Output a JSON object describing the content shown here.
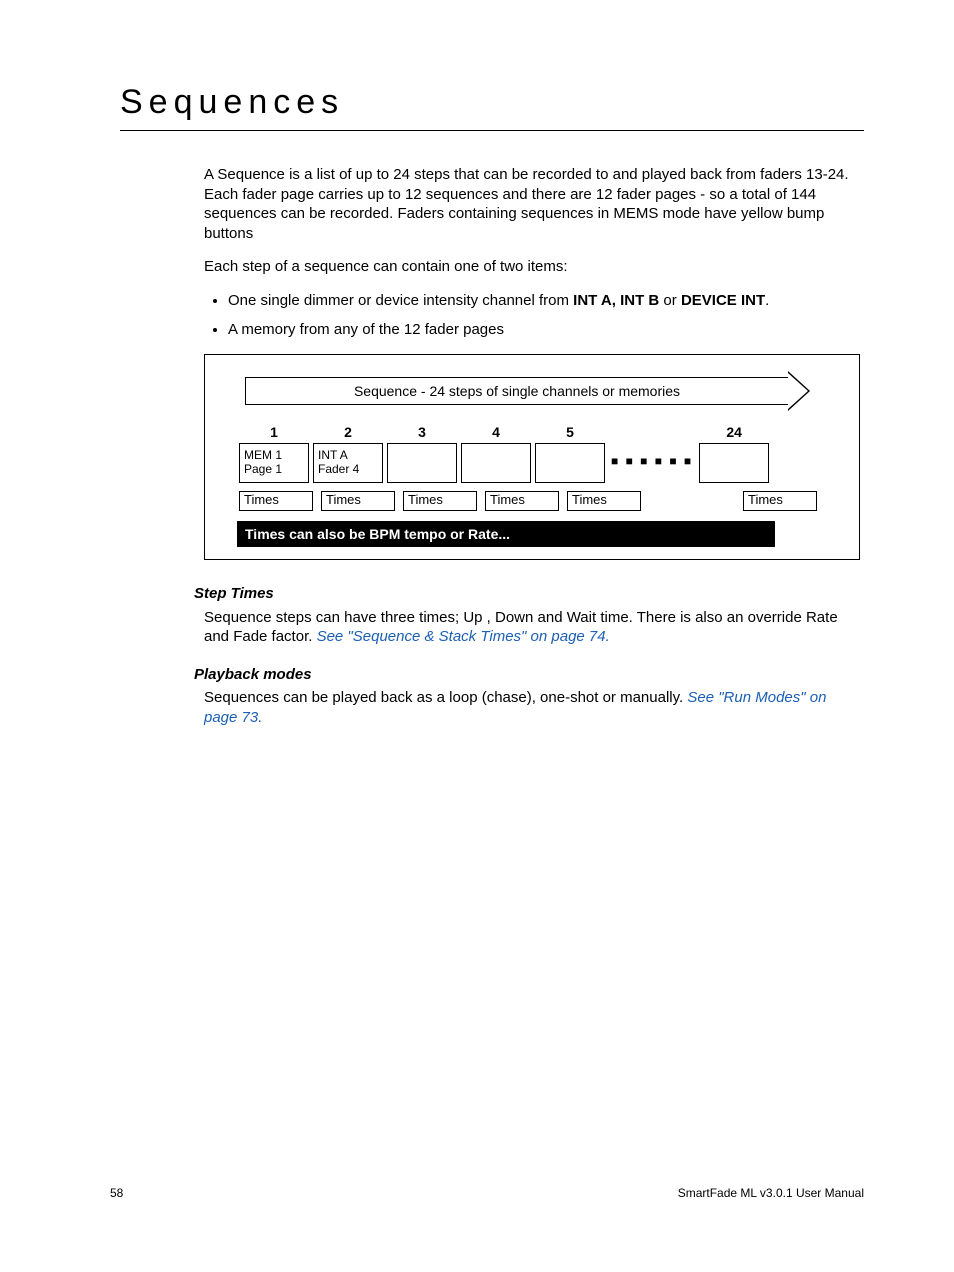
{
  "heading": "Sequences",
  "para1": "A Sequence is a list of up to 24 steps that can be recorded to and played back from faders 13-24. Each fader page carries up to 12 sequences and there are 12 fader pages - so a total of 144 sequences can be recorded. Faders containing sequences in MEMS mode have yellow bump buttons",
  "para2": "Each step of a sequence can contain one of two items:",
  "bullet1_pre": "One single dimmer or device intensity channel from ",
  "bullet1_bold1": "INT A, INT B",
  "bullet1_mid": " or ",
  "bullet1_bold2": "DEVICE INT",
  "bullet1_post": ".",
  "bullet2": "A memory from any of the 12 fader pages",
  "diagram": {
    "title": "Sequence - 24 steps of single channels or memories",
    "steps": [
      "1",
      "2",
      "3",
      "4",
      "5"
    ],
    "step_last": "24",
    "box1_line1": "MEM 1",
    "box1_line2": "Page 1",
    "box2_line1": "INT A",
    "box2_line2": "Fader 4",
    "times_label": "Times",
    "caption": "Times can also be BPM tempo or Rate..."
  },
  "sub1_title": "Step Times",
  "sub1_text_pre": "Sequence steps can have three times;  Up , Down and Wait time. There is also an override Rate and Fade factor. ",
  "sub1_link": "See \"Sequence & Stack Times\" on page 74.",
  "sub2_title": "Playback modes",
  "sub2_text_pre": "Sequences can be played back as a loop (chase), one-shot or manually. ",
  "sub2_link": "See \"Run Modes\" on page 73.",
  "footer_page": "58",
  "footer_doc": "SmartFade ML v3.0.1 User Manual"
}
